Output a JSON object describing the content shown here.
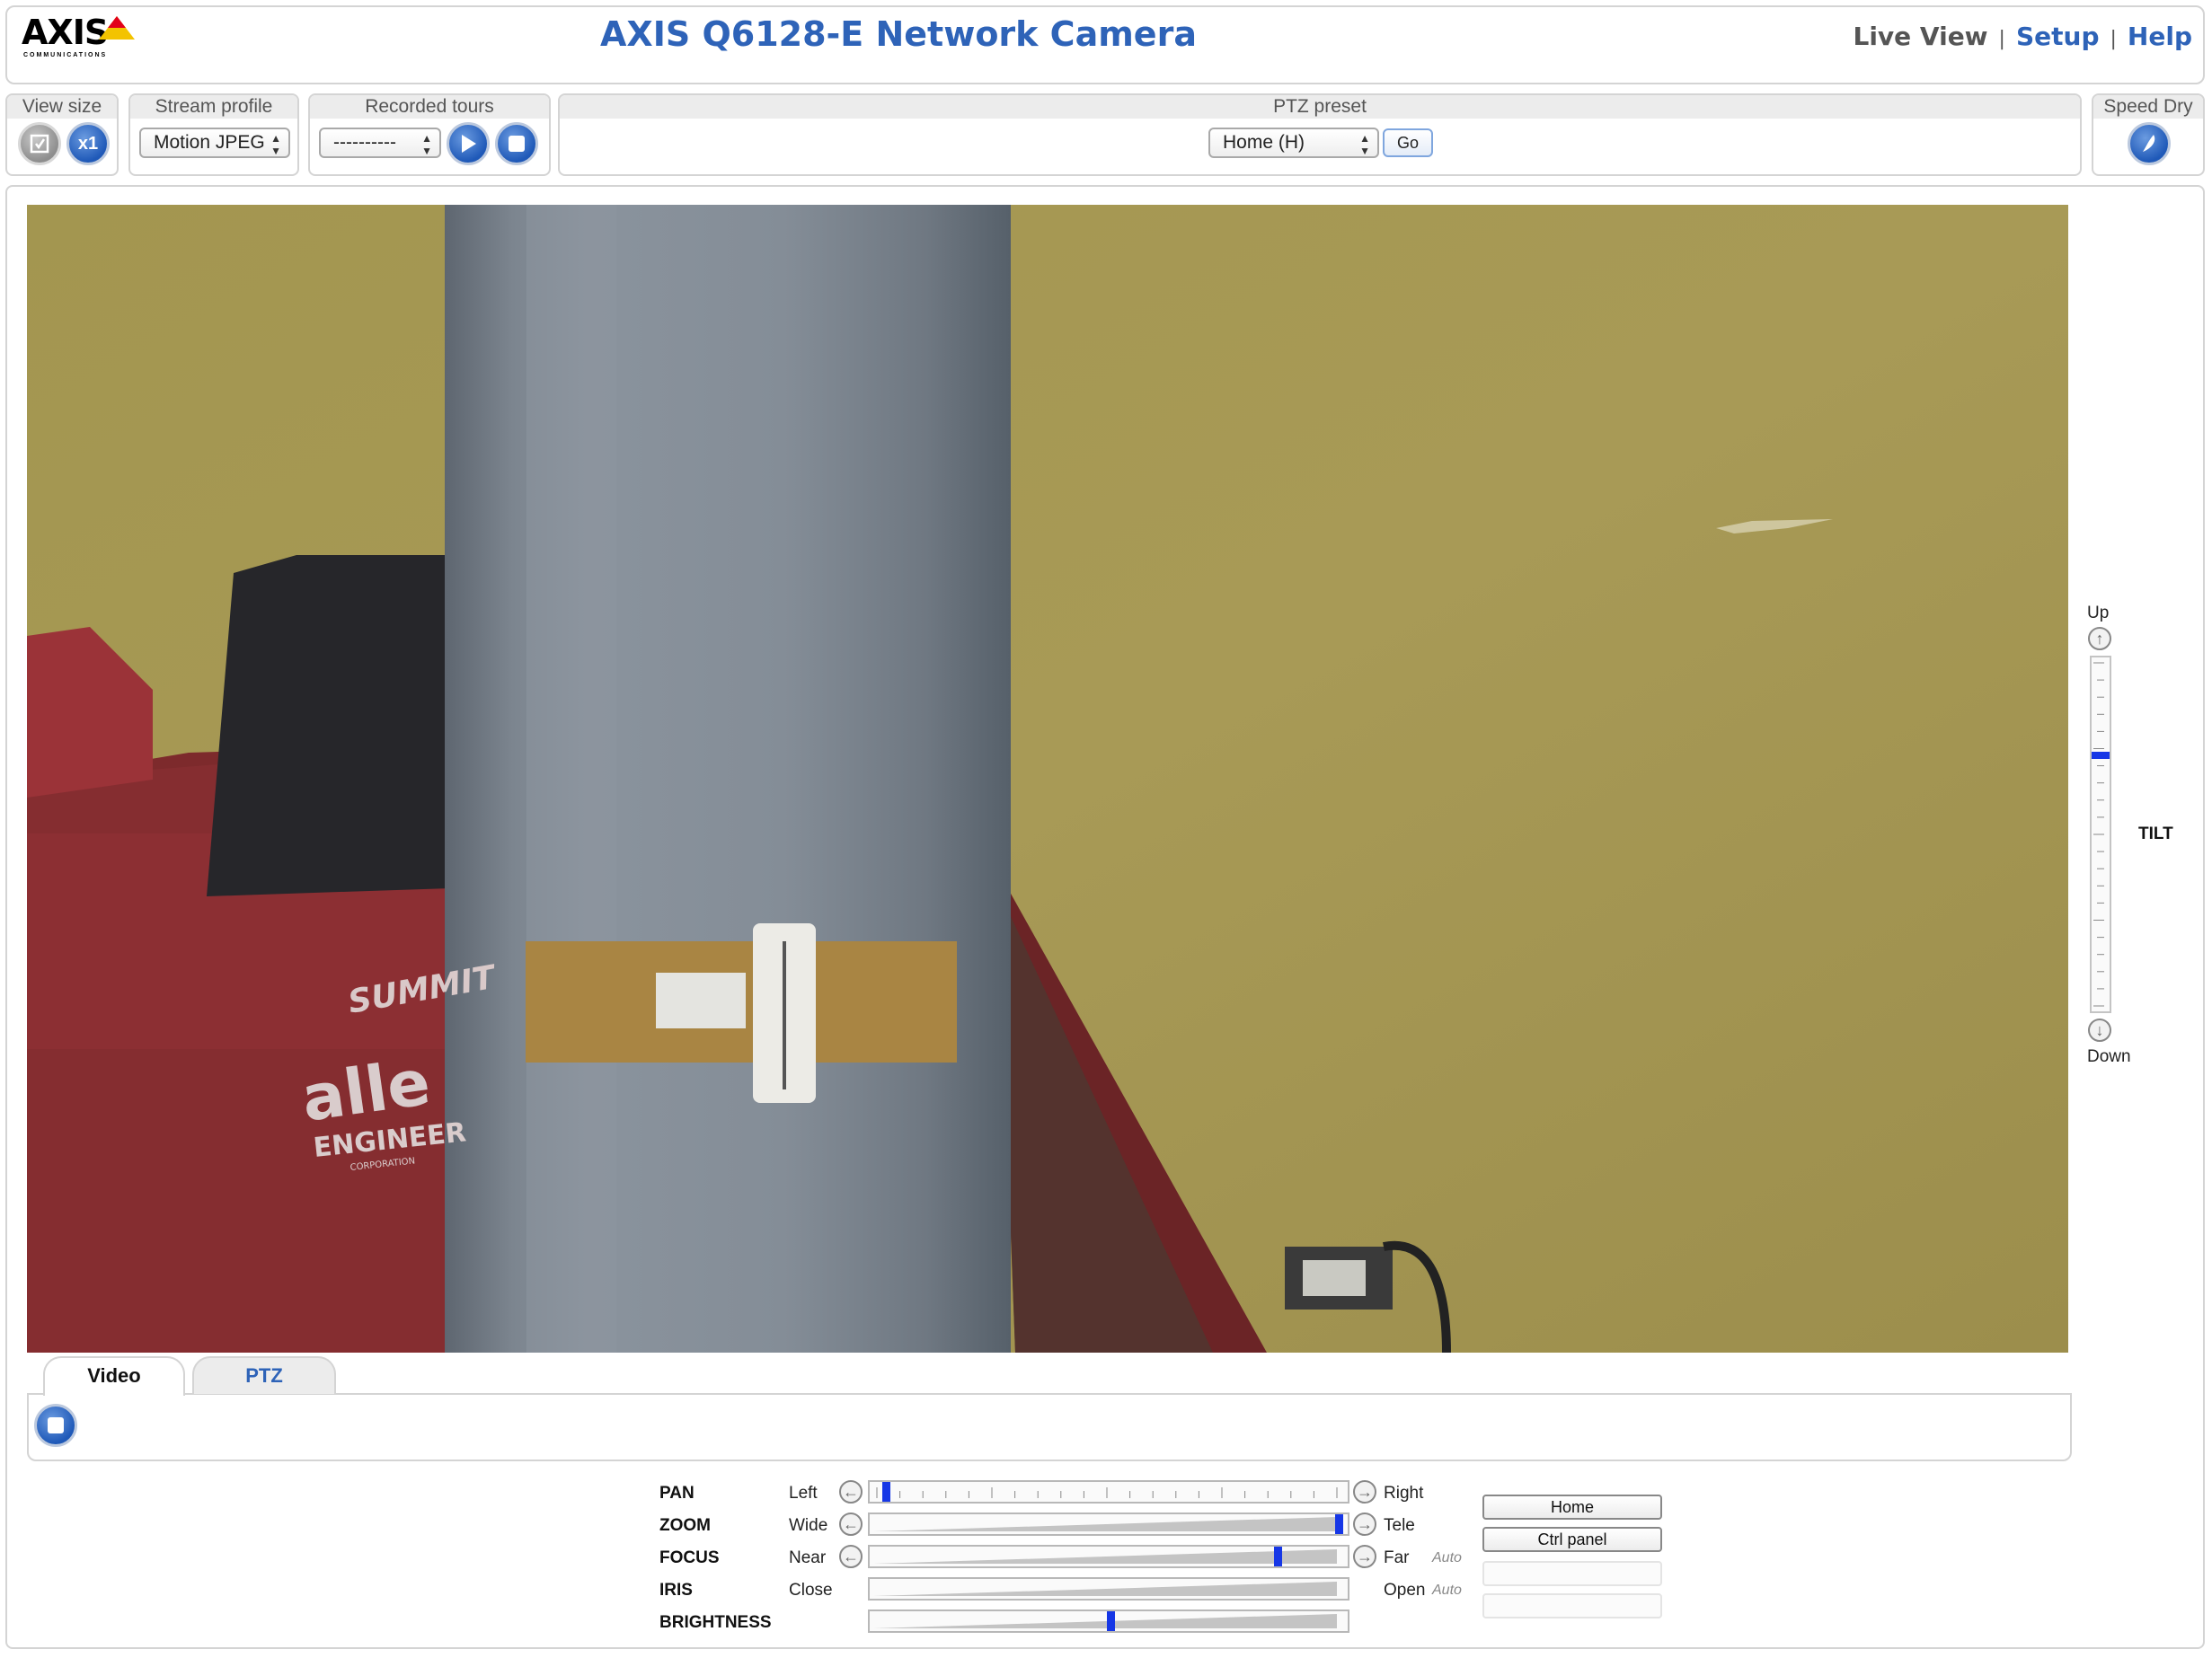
{
  "header": {
    "logo_text": "AXIS",
    "logo_subtext": "COMMUNICATIONS",
    "title": "AXIS Q6128-E Network Camera",
    "nav": [
      {
        "label": "Live View",
        "active": true
      },
      {
        "label": "Setup",
        "active": false
      },
      {
        "label": "Help",
        "active": false
      }
    ],
    "nav_separator": "|"
  },
  "toolbar": {
    "view_size": {
      "label": "View size",
      "scale_button": "x1"
    },
    "stream_profile": {
      "label": "Stream profile",
      "value": "Motion JPEG"
    },
    "recorded_tours": {
      "label": "Recorded tours",
      "value": "----------"
    },
    "ptz_preset": {
      "label": "PTZ preset",
      "value": "Home (H)",
      "go_label": "Go"
    },
    "speed_dry": {
      "label": "Speed Dry"
    }
  },
  "video": {
    "scene_signs": [
      "SUMMIT",
      "alle",
      "ENGINEER",
      "CORPORATION"
    ]
  },
  "tilt": {
    "title": "TILT",
    "up_label": "Up",
    "down_label": "Down",
    "position": 0.27
  },
  "tabs": [
    {
      "label": "Video",
      "active": true
    },
    {
      "label": "PTZ",
      "active": false
    }
  ],
  "controls": [
    {
      "name": "PAN",
      "low": "Left",
      "high": "Right",
      "auto": "",
      "value": 0.02,
      "style": "ticks",
      "arrows": true
    },
    {
      "name": "ZOOM",
      "low": "Wide",
      "high": "Tele",
      "auto": "",
      "value": 0.99,
      "style": "wedge",
      "arrows": true
    },
    {
      "name": "FOCUS",
      "low": "Near",
      "high": "Far",
      "auto": "Auto",
      "value": 0.86,
      "style": "wedge",
      "arrows": true
    },
    {
      "name": "IRIS",
      "low": "Close",
      "high": "Open",
      "auto": "Auto",
      "value": null,
      "style": "wedge",
      "arrows": false
    },
    {
      "name": "BRIGHTNESS",
      "low": "",
      "high": "",
      "auto": "",
      "value": 0.5,
      "style": "wedge",
      "arrows": false
    }
  ],
  "side_buttons": {
    "home": "Home",
    "ctrl_panel": "Ctrl panel"
  },
  "colors": {
    "accent": "#2e63b8",
    "slider_thumb": "#1637e6",
    "border": "#d4d4d4"
  },
  "icons": {
    "view_size_full": "fullscreen-icon",
    "play": "play-icon",
    "stop": "stop-icon",
    "speed_dry": "speed-dry-icon",
    "arrow_left": "arrow-left-icon",
    "arrow_right": "arrow-right-icon",
    "arrow_up": "arrow-up-icon",
    "arrow_down": "arrow-down-icon"
  }
}
